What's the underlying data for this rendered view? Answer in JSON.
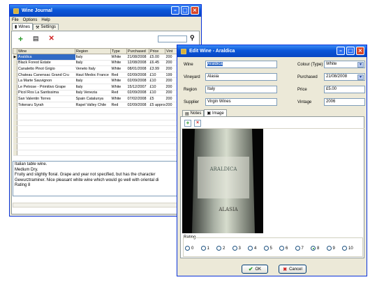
{
  "main": {
    "title": "Wine Journal",
    "menu": [
      "File",
      "Options",
      "Help"
    ],
    "tabs": [
      {
        "label": "Wines"
      },
      {
        "label": "Settings"
      }
    ],
    "columns": [
      "Wine",
      "Region",
      "Type",
      "Purchased",
      "Price",
      "Vint"
    ],
    "rows": [
      [
        "Araldica",
        "Italy",
        "White",
        "21/08/2008",
        "£5.00",
        "200"
      ],
      [
        "Black Forest Estate",
        "Italy",
        "White",
        "12/08/2008",
        "£6.45",
        "200"
      ],
      [
        "Canaletto Pinot Grigio",
        "Veneto Italy",
        "White",
        "08/01/2008",
        "£3.99",
        "200"
      ],
      [
        "Chateau Canensac Grand Cru",
        "Haut Medoc France",
        "Red",
        "02/09/2008",
        "£10",
        "199"
      ],
      [
        "La Marte Sauvignon",
        "Italy",
        "White",
        "02/09/2008",
        "£10",
        "200"
      ],
      [
        "Le Petrose - Primitivo Grape",
        "Italy",
        "White",
        "15/12/2007",
        "£10",
        "200"
      ],
      [
        "Picol Ros La Santissima",
        "Italy Venezia",
        "Red",
        "02/09/2008",
        "£10",
        "200"
      ],
      [
        "San Valentin Torres",
        "Spain Catalunya",
        "White",
        "07/02/2008",
        "£5",
        "200"
      ],
      [
        "Tokeraru Syrah",
        "Rapel Valley Chile",
        "Red",
        "02/09/2008",
        "£5 approx",
        "200"
      ]
    ],
    "notes": [
      "Italian table wine.",
      "Medium Dry.",
      "Fruity and slightly floral. Grape and year not specified, but has the character",
      "Gewurztraminer. Nice pleasant white wine which would go well with oriental di",
      "Rating 8"
    ]
  },
  "edit": {
    "title": "Edit Wine - Araldica",
    "labels": {
      "wine": "Wine",
      "vineyard": "Vineyard",
      "region": "Region",
      "supplier": "Supplier",
      "colour": "Colour (Type)",
      "purchased": "Purchased",
      "price": "Price",
      "vintage": "Vintage"
    },
    "values": {
      "wine": "Araldica",
      "vineyard": "Alasia",
      "region": "Italy",
      "supplier": "Virgin Wines",
      "colour": "White",
      "purchased": "21/08/2008",
      "price": "£5.00",
      "vintage": "2006"
    },
    "tabs": [
      {
        "label": "Notes"
      },
      {
        "label": "Image"
      }
    ],
    "photo_text": {
      "brand": "ARALDICA",
      "label": "ALASIA"
    },
    "rating_label": "Rating",
    "rating_options": [
      "0",
      "1",
      "2",
      "3",
      "4",
      "5",
      "6",
      "7",
      "8",
      "9",
      "10"
    ],
    "rating_selected": 8,
    "ok_label": "OK",
    "cancel_label": "Cancel"
  }
}
